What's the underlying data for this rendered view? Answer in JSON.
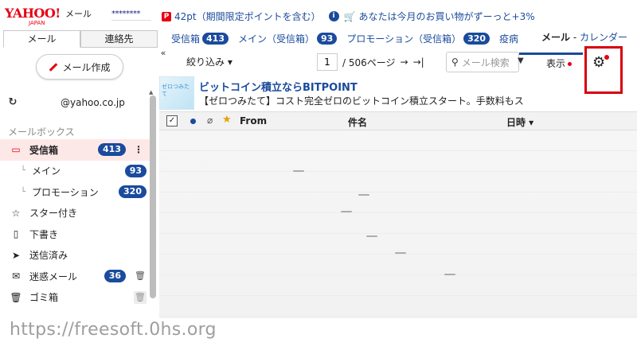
{
  "header": {
    "logo_main": "YAHOO!",
    "logo_sub": "JAPAN",
    "logo_service": "メール",
    "account": "********",
    "points_text": "42pt（期間限定ポイントを含む）",
    "promo_text": "あなたは今月のお買い物がずーっと+3%"
  },
  "tabs": {
    "mail": "メール",
    "contacts": "連絡先"
  },
  "folder_tabs": [
    {
      "label": "受信箱",
      "count": "413"
    },
    {
      "label": "メイン（受信箱）",
      "count": "93"
    },
    {
      "label": "プロモーション（受信箱）",
      "count": "320"
    },
    {
      "label": "疫病",
      "count": ""
    }
  ],
  "service_links": {
    "current": "メール",
    "separator": " - ",
    "calendar": "カレンダー"
  },
  "sidebar": {
    "compose": "メール作成",
    "address": "@yahoo.co.jp",
    "mailbox_heading": "メールボックス",
    "folders": [
      {
        "label": "受信箱",
        "count": "413"
      },
      {
        "label": "メイン",
        "count": "93"
      },
      {
        "label": "プロモーション",
        "count": "320"
      },
      {
        "label": "スター付き"
      },
      {
        "label": "下書き"
      },
      {
        "label": "送信済み"
      },
      {
        "label": "迷惑メール",
        "count": "36"
      },
      {
        "label": "ゴミ箱"
      }
    ]
  },
  "toolbar": {
    "filter": "絞り込み ▾",
    "page_current": "1",
    "page_total": "/ 506ページ",
    "search_placeholder": "メール検索",
    "display": "表示"
  },
  "ad": {
    "thumb_text": "ゼロつみたて",
    "title": "ビットコイン積立ならBITPOINT",
    "body": "【ゼロつみたて】コスト完全ゼロのビットコイン積立スタート。手数料もス"
  },
  "list_header": {
    "from": "From",
    "subject": "件名",
    "date": "日時 ▾"
  },
  "watermark": "https://freesoft.0hs.org",
  "colors": {
    "brand_red": "#e60012",
    "link_blue": "#1a4b9c",
    "highlight": "#d7000f"
  }
}
